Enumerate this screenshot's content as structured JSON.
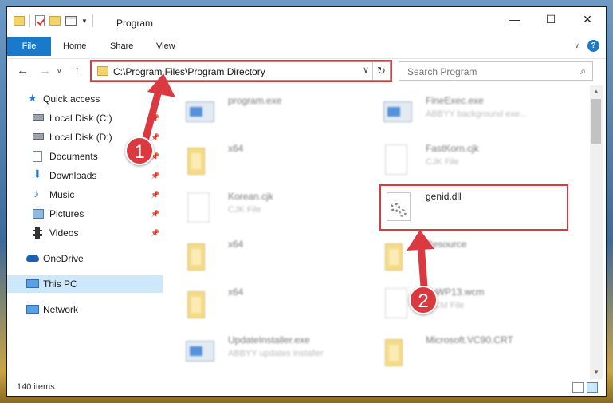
{
  "window": {
    "title": "Program",
    "controls": {
      "minimize": "—",
      "maximize": "☐",
      "close": "✕"
    }
  },
  "ribbon": {
    "tabs": [
      {
        "label": "File",
        "active": true
      },
      {
        "label": "Home"
      },
      {
        "label": "Share"
      },
      {
        "label": "View"
      }
    ],
    "help": "?"
  },
  "nav": {
    "address": "C:\\Program Files\\Program Directory",
    "search_placeholder": "Search Program"
  },
  "sidebar": {
    "items": [
      {
        "label": "Quick access",
        "icon": "star-icon",
        "pinned": false
      },
      {
        "label": "Local Disk (C:)",
        "icon": "drive-icon",
        "pinned": true
      },
      {
        "label": "Local Disk (D:)",
        "icon": "drive-icon",
        "pinned": true
      },
      {
        "label": "Documents",
        "icon": "documents-icon",
        "pinned": true
      },
      {
        "label": "Downloads",
        "icon": "downloads-icon",
        "pinned": true
      },
      {
        "label": "Music",
        "icon": "music-icon",
        "pinned": true
      },
      {
        "label": "Pictures",
        "icon": "pictures-icon",
        "pinned": true
      },
      {
        "label": "Videos",
        "icon": "videos-icon",
        "pinned": true
      },
      {
        "label": "OneDrive",
        "icon": "cloud-icon",
        "pinned": false
      },
      {
        "label": "This PC",
        "icon": "computer-icon",
        "pinned": false,
        "selected": true
      },
      {
        "label": "Network",
        "icon": "network-icon",
        "pinned": false
      }
    ]
  },
  "files": [
    {
      "name": "program.exe",
      "type": "",
      "icon": "exe-icon",
      "blurred": true
    },
    {
      "name": "FineExec.exe",
      "type": "ABBYY background exe...",
      "icon": "exe-icon",
      "blurred": true
    },
    {
      "name": "x64",
      "type": "",
      "icon": "folder-icon",
      "blurred": true
    },
    {
      "name": "FastKorn.cjk",
      "type": "CJK File",
      "icon": "document-icon",
      "blurred": true
    },
    {
      "name": "Korean.cjk",
      "type": "CJK File",
      "icon": "document-icon",
      "blurred": true
    },
    {
      "name": "genid.dll",
      "type": "",
      "icon": "dll-gear-icon",
      "blurred": false
    },
    {
      "name": "x64",
      "type": "",
      "icon": "folder-icon",
      "blurred": true
    },
    {
      "name": "Resource",
      "type": "",
      "icon": "folder-icon",
      "blurred": true
    },
    {
      "name": "x64",
      "type": "",
      "icon": "folder-icon",
      "blurred": true
    },
    {
      "name": "ToWP13.wcm",
      "type": "WCM File",
      "icon": "document-icon",
      "blurred": true
    },
    {
      "name": "UpdateInstaller.exe",
      "type": "ABBYY updates installer",
      "icon": "exe-icon",
      "blurred": true
    },
    {
      "name": "Microsoft.VC90.CRT",
      "type": "",
      "icon": "folder-icon",
      "blurred": true
    }
  ],
  "status": {
    "item_count": "140 items"
  },
  "annotations": [
    {
      "number": "1",
      "target": "address bar"
    },
    {
      "number": "2",
      "target": "genid.dll"
    }
  ],
  "colors": {
    "accent": "#1979ca",
    "highlight": "#d9393f",
    "selection": "#cde8fb"
  }
}
